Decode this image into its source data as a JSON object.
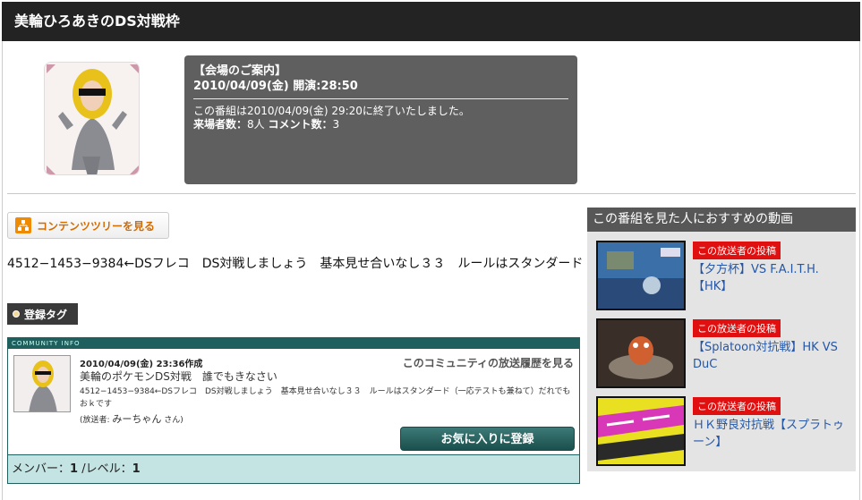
{
  "page_title": "美輪ひろあきのDS対戦枠",
  "info": {
    "heading": "【会場のご案内】",
    "date_line": "2010/04/09(金) 開演:28:50",
    "ended": "この番組は2010/04/09(金) 29:20に終了いたしました。",
    "visitors_label": "来場者数：",
    "visitors": "8人",
    "comments_label": "コメント数：",
    "comments": "3"
  },
  "tree_button": "コンテンツツリーを見る",
  "description": "4512−1453−9384←DSフレコ　DS対戦しましょう　基本見せ合いなし３３　ルールはスタンダード",
  "tag_button": "登録タグ",
  "community": {
    "header": "COMMUNITY INFO",
    "created": "2010/04/09(金) 23:36作成",
    "name": "美輪のポケモンDS対戦　誰でもきなさい",
    "desc": "4512−1453−9384←DSフレコ　DS対戦しましょう　基本見せ合いなし３３　ルールはスタンダード（一応テストも兼ねて）だれでもおｋです",
    "broadcaster_prefix": "(放送者:",
    "broadcaster": "みーちゃん",
    "broadcaster_suffix": "さん)",
    "history_link": "このコミュニティの放送履歴を見る",
    "fav_button": "お気に入りに登録",
    "member_label": "メンバー：",
    "members": "1",
    "level_label": "/レベル：",
    "level": "1"
  },
  "recommend": {
    "heading": "この番組を見た人におすすめの動画",
    "items": [
      {
        "badge": "この放送者の投稿",
        "title": "【夕方杯】VS F.A.I.T.H.【HK】"
      },
      {
        "badge": "この放送者の投稿",
        "title": "【Splatoon対抗戦】HK VS　DuC"
      },
      {
        "badge": "この放送者の投稿",
        "title": "ＨＫ野良対抗戦【スプラトゥーン】"
      }
    ]
  }
}
